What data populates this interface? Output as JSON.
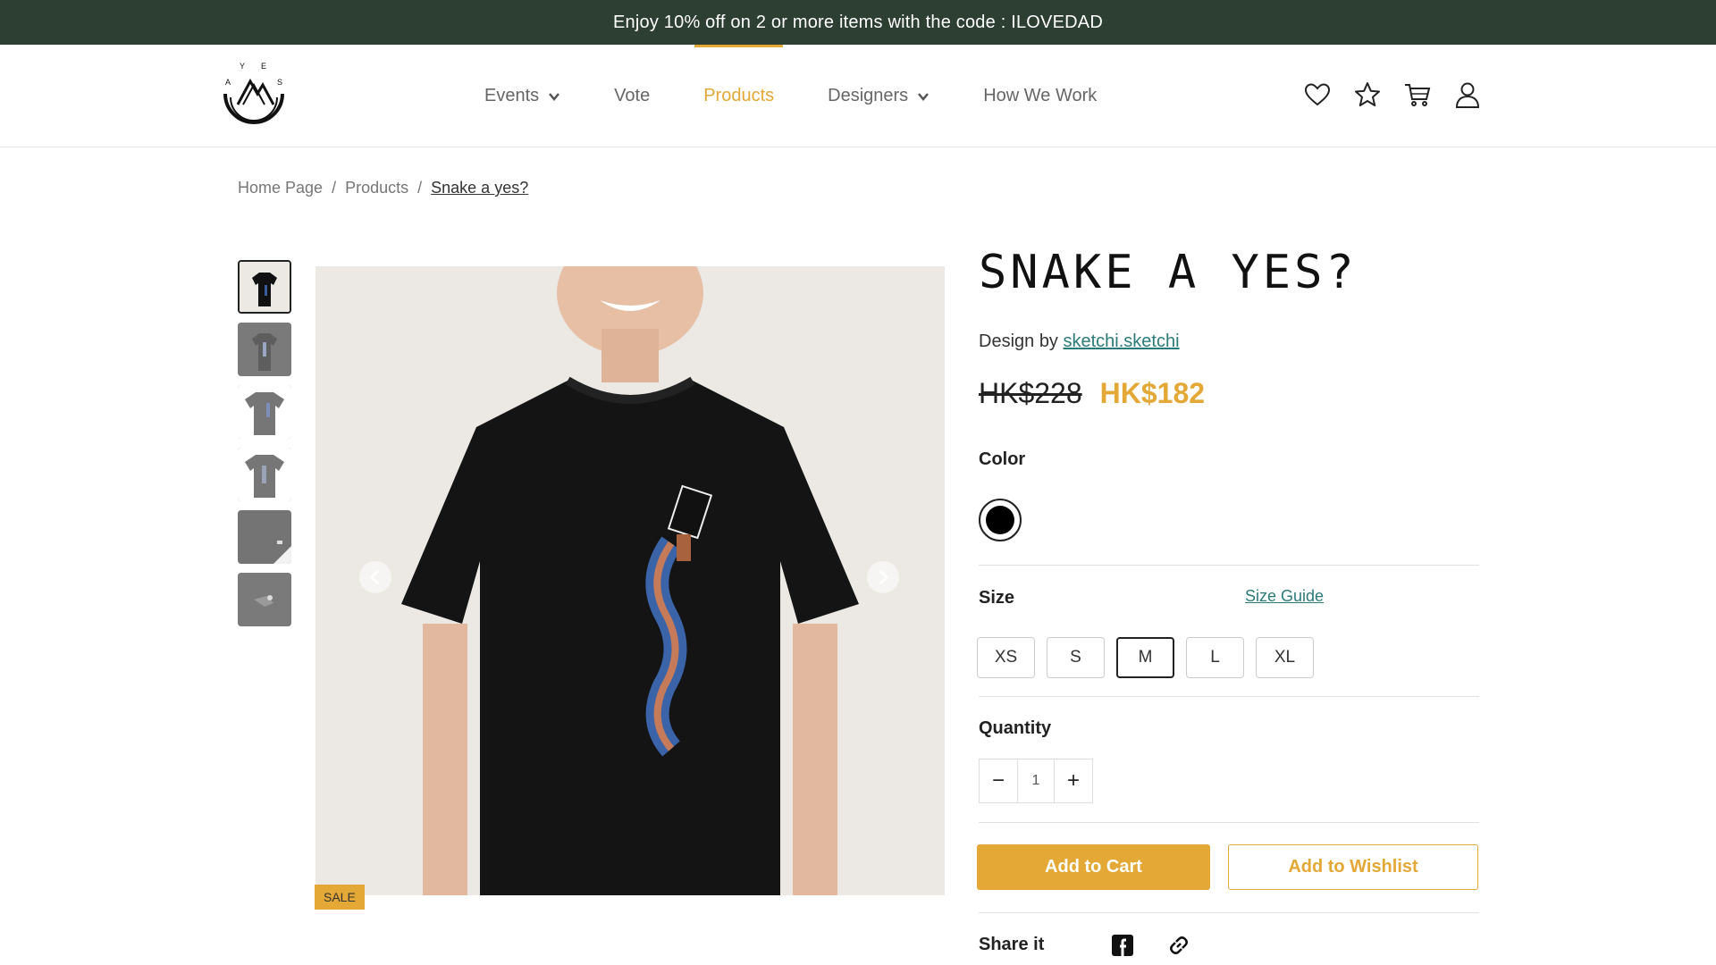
{
  "promo": {
    "text": "Enjoy 10% off on 2 or more items with the code : ILOVEDAD"
  },
  "logo": {
    "letters": "AYES",
    "icon": "ayes-logo"
  },
  "nav": {
    "items": [
      {
        "label": "Events",
        "has_dropdown": true
      },
      {
        "label": "Vote",
        "has_dropdown": false
      },
      {
        "label": "Products",
        "has_dropdown": false,
        "active": true
      },
      {
        "label": "Designers",
        "has_dropdown": true
      },
      {
        "label": "How We Work",
        "has_dropdown": false
      }
    ]
  },
  "header_icons": [
    "heart-icon",
    "star-icon",
    "cart-icon",
    "user-icon"
  ],
  "breadcrumb": {
    "items": [
      "Home Page",
      "/",
      "Products",
      "/",
      "Snake a yes?"
    ]
  },
  "gallery": {
    "thumb_count": 6,
    "selected": 1,
    "badge": "SALE"
  },
  "product": {
    "title": "SNAKE A YES?",
    "design_by_label": "Design by",
    "designer": "sketchi.sketchi",
    "old_price": "HK$228",
    "new_price": "HK$182",
    "color_label": "Color",
    "selected_color": "#000000",
    "size_label": "Size",
    "size_guide": "Size Guide",
    "sizes": [
      "XS",
      "S",
      "M",
      "L",
      "XL"
    ],
    "selected_size": "M",
    "quantity_label": "Quantity",
    "quantity": "1",
    "minus": "−",
    "plus": "+",
    "add_to_cart": "Add to Cart",
    "add_to_wishlist": "Add to Wishlist",
    "share_label": "Share it"
  },
  "colors": {
    "accent": "#e3a835",
    "promo_bg": "#2d3e33",
    "link": "#2b7a7a"
  }
}
